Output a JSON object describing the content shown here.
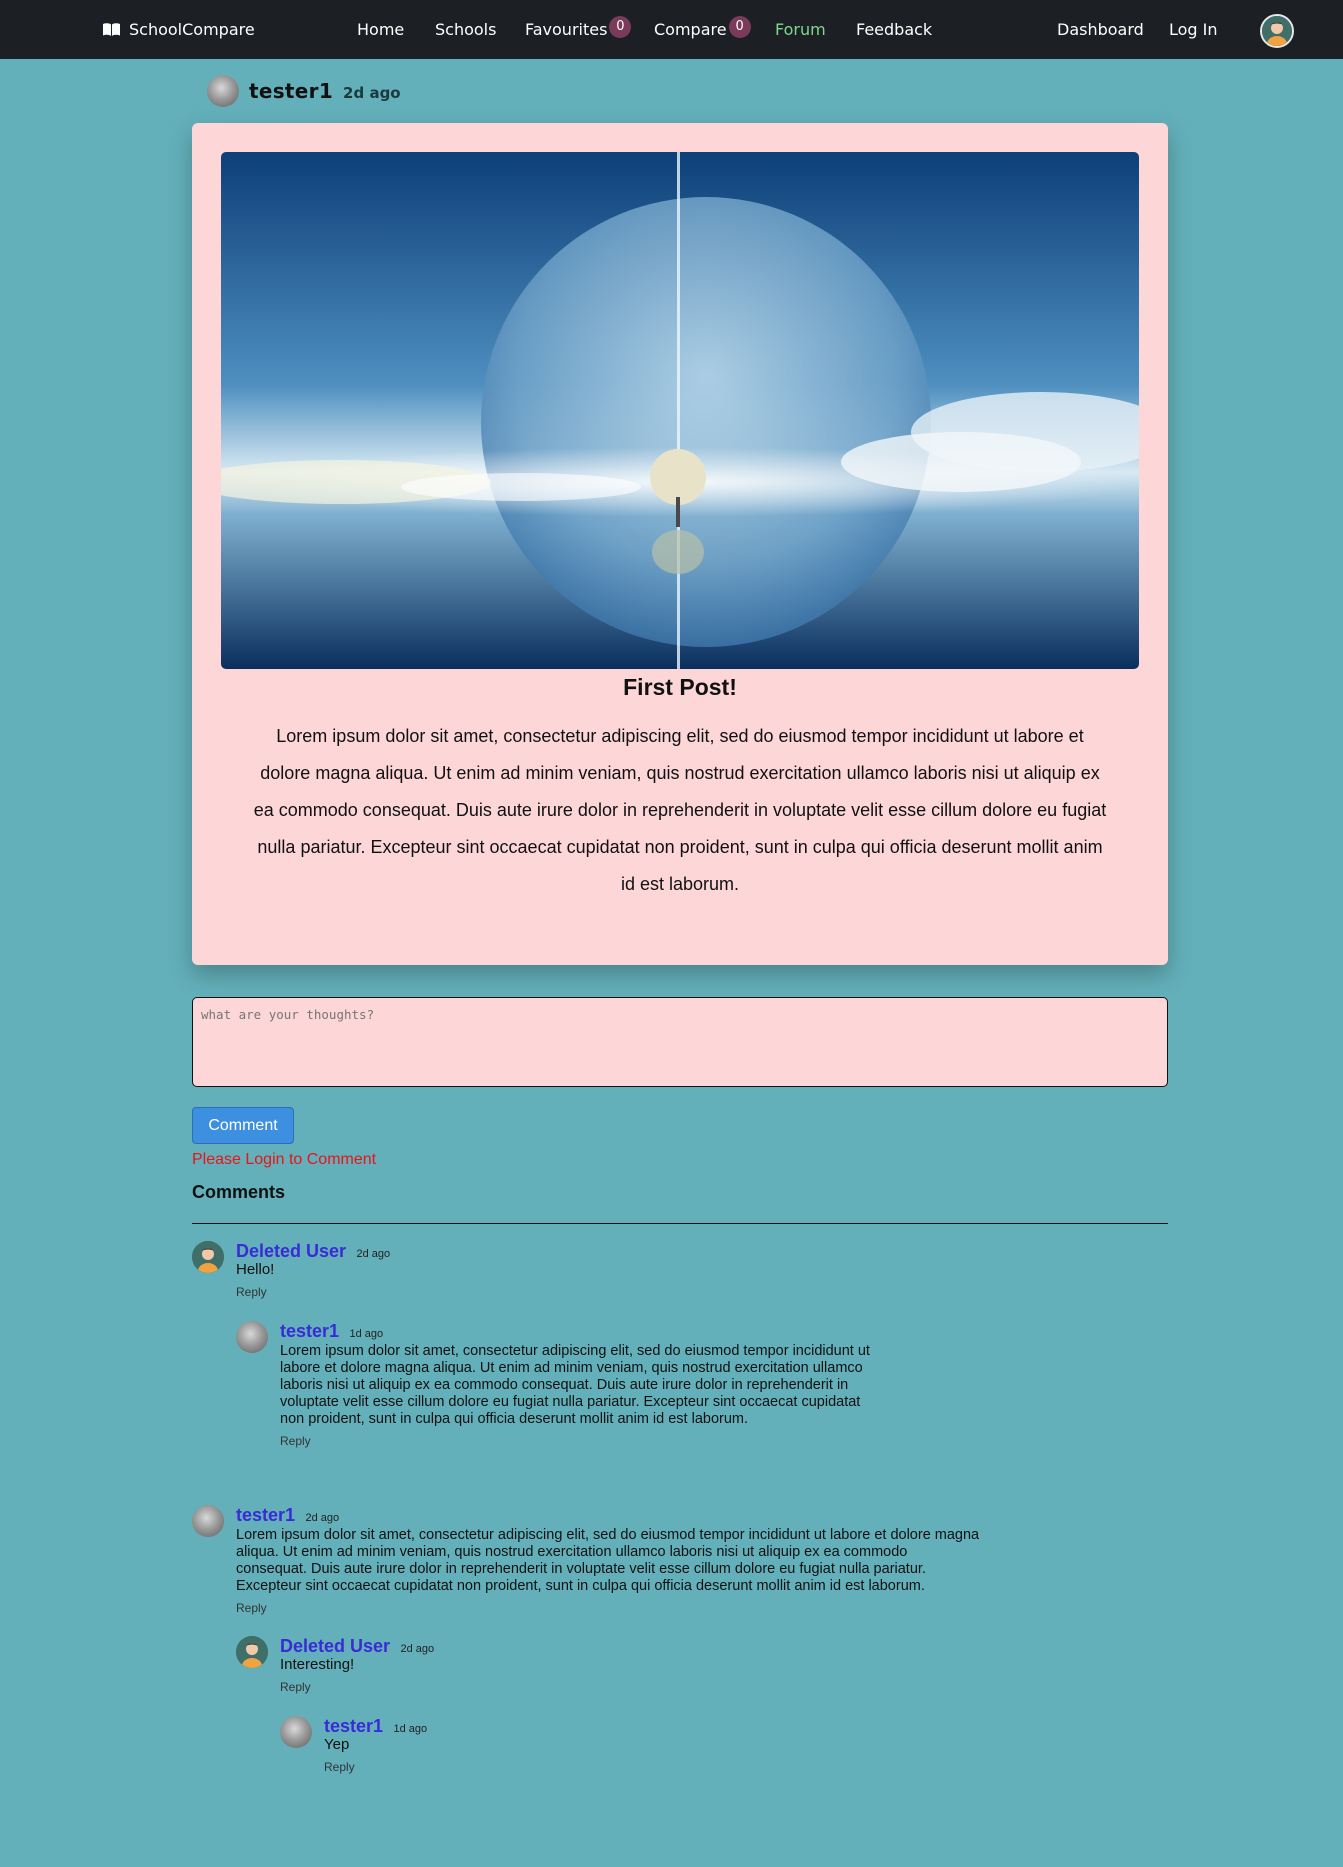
{
  "nav": {
    "brand": "SchoolCompare",
    "home": "Home",
    "schools": "Schools",
    "favourites": "Favourites",
    "favourites_count": "0",
    "compare": "Compare",
    "compare_count": "0",
    "forum": "Forum",
    "feedback": "Feedback",
    "dashboard": "Dashboard",
    "login": "Log In",
    "active_color": "#7fd88a"
  },
  "post": {
    "author": "tester1",
    "time": "2d ago",
    "title": "First Post!",
    "body": "Lorem ipsum dolor sit amet, consectetur adipiscing elit, sed do eiusmod tempor incididunt ut labore et dolore magna aliqua. Ut enim ad minim veniam, quis nostrud exercitation ullamco laboris nisi ut aliquip ex ea commodo consequat. Duis aute irure dolor in reprehenderit in voluptate velit esse cillum dolore eu fugiat nulla pariatur. Excepteur sint occaecat cupidatat non proident, sunt in culpa qui officia deserunt mollit anim id est laborum."
  },
  "form": {
    "placeholder": "what are your thoughts?",
    "button": "Comment",
    "login_message": "Please Login to Comment"
  },
  "comments_heading": "Comments",
  "comments": [
    {
      "author": "Deleted User",
      "time": "2d ago",
      "text": "Hello!",
      "reply": "Reply",
      "replies": [
        {
          "author": "tester1",
          "time": "1d ago",
          "lines": [
            "Lorem ipsum dolor sit amet, consectetur adipiscing elit, sed do eiusmod tempor incididunt ut",
            "labore et dolore magna aliqua. Ut enim ad minim veniam, quis nostrud exercitation ullamco",
            "laboris nisi ut aliquip ex ea commodo consequat. Duis aute irure dolor in reprehenderit in",
            "voluptate velit esse cillum dolore eu fugiat nulla pariatur. Excepteur sint occaecat cupidatat",
            "non proident, sunt in culpa qui officia deserunt mollit anim id est laborum."
          ],
          "reply": "Reply"
        }
      ]
    },
    {
      "author": "tester1",
      "time": "2d ago",
      "lines": [
        "Lorem ipsum dolor sit amet, consectetur adipiscing elit, sed do eiusmod tempor incididunt ut labore et dolore magna",
        "aliqua. Ut enim ad minim veniam, quis nostrud exercitation ullamco laboris nisi ut aliquip ex ea commodo",
        "consequat. Duis aute irure dolor in reprehenderit in voluptate velit esse cillum dolore eu fugiat nulla pariatur.",
        "Excepteur sint occaecat cupidatat non proident, sunt in culpa qui officia deserunt mollit anim id est laborum."
      ],
      "reply": "Reply",
      "replies": [
        {
          "author": "Deleted User",
          "time": "2d ago",
          "text": "Interesting!",
          "reply": "Reply",
          "replies": [
            {
              "author": "tester1",
              "time": "1d ago",
              "text": "Yep",
              "reply": "Reply"
            }
          ]
        }
      ]
    }
  ]
}
